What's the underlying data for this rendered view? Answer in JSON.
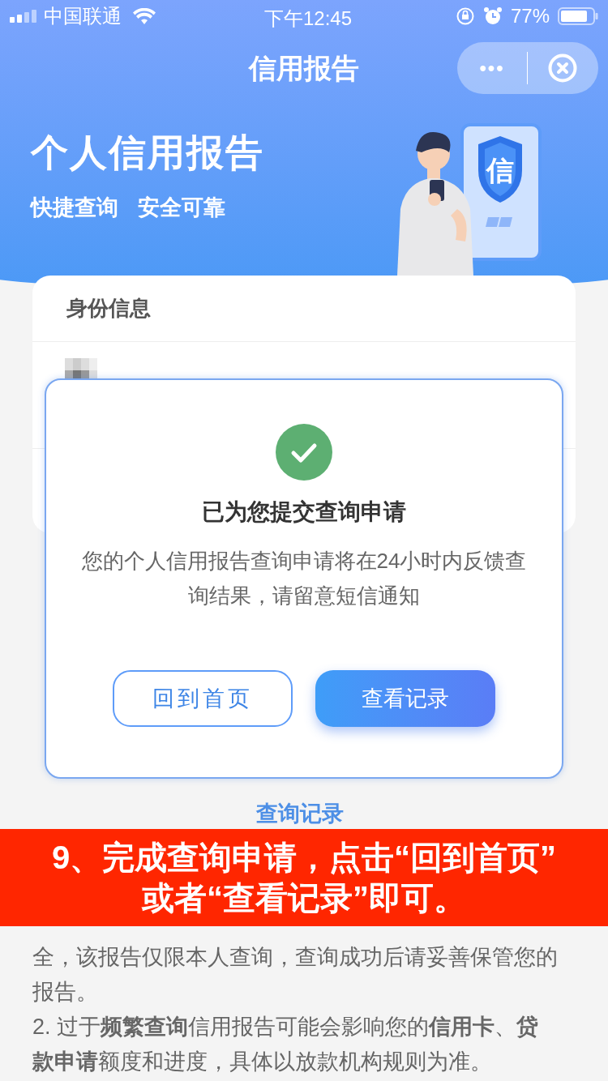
{
  "status_bar": {
    "carrier": "中国联通",
    "time": "下午12:45",
    "battery": "77%"
  },
  "nav": {
    "title": "信用报告",
    "more": "•••"
  },
  "hero": {
    "title": "个人信用报告",
    "tags": [
      "快捷查询",
      "安全可靠"
    ],
    "shield_text": "信"
  },
  "card": {
    "section_title": "身份信息"
  },
  "dialog": {
    "title": "已为您提交查询申请",
    "message": "您的个人信用报告查询申请将在24小时内反馈查询结果，请留意短信通知",
    "buttons": [
      {
        "label": "回到首页",
        "kind": "outline"
      },
      {
        "label": "查看记录",
        "kind": "primary"
      }
    ]
  },
  "records_link": "查询记录",
  "caption": [
    "9、完成查询申请，点击“回到首页”",
    "或者“查看记录”即可。"
  ],
  "notes": [
    "全，该报告仅限本人查询，查询成功后请妥善保管您的报告。",
    "2. 过于**频繁查询**信用报告可能会影响您的**信用卡**、**贷款申请**额度和进度，具体以放款机构规则为准。"
  ]
}
